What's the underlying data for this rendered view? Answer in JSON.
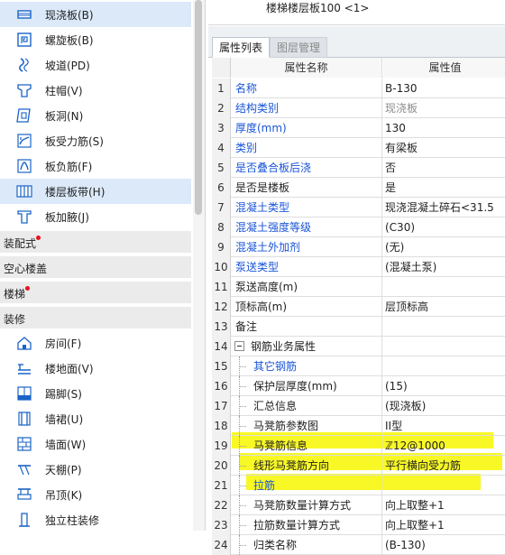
{
  "left_panel": {
    "items_top": [
      {
        "label": "现浇板(B)",
        "icon": "cast-slab-icon",
        "selected": true
      },
      {
        "label": "螺旋板(B)",
        "icon": "spiral-slab-icon",
        "selected": false
      },
      {
        "label": "坡道(PD)",
        "icon": "ramp-icon",
        "selected": false
      },
      {
        "label": "柱帽(V)",
        "icon": "column-cap-icon",
        "selected": false
      },
      {
        "label": "板洞(N)",
        "icon": "slab-hole-icon",
        "selected": false
      },
      {
        "label": "板受力筋(S)",
        "icon": "slab-main-rebar-icon",
        "selected": false
      },
      {
        "label": "板负筋(F)",
        "icon": "slab-negative-rebar-icon",
        "selected": false
      },
      {
        "label": "楼层板带(H)",
        "icon": "floor-slab-strip-icon",
        "selected": true
      },
      {
        "label": "板加腋(J)",
        "icon": "slab-haunch-icon",
        "selected": false
      }
    ],
    "groups": [
      {
        "label": "装配式",
        "has_dot": true
      },
      {
        "label": "空心楼盖",
        "has_dot": false
      },
      {
        "label": "楼梯",
        "has_dot": true
      },
      {
        "label": "装修",
        "has_dot": false
      }
    ],
    "items_bottom": [
      {
        "label": "房间(F)",
        "icon": "room-icon"
      },
      {
        "label": "楼地面(V)",
        "icon": "floor-surface-icon"
      },
      {
        "label": "踢脚(S)",
        "icon": "skirting-icon"
      },
      {
        "label": "墙裙(U)",
        "icon": "dado-icon"
      },
      {
        "label": "墙面(W)",
        "icon": "wall-surface-icon"
      },
      {
        "label": "天棚(P)",
        "icon": "ceiling-icon"
      },
      {
        "label": "吊顶(K)",
        "icon": "suspended-ceiling-icon"
      },
      {
        "label": "独立柱装修",
        "icon": "column-finish-icon"
      }
    ]
  },
  "preview": {
    "title": "楼梯楼层板100 <1>"
  },
  "tabs": [
    {
      "label": "属性列表",
      "active": true
    },
    {
      "label": "图层管理",
      "active": false
    }
  ],
  "grid": {
    "headers": {
      "name": "属性名称",
      "value": "属性值"
    },
    "rows": [
      {
        "num": "1",
        "name": "名称",
        "value": "B-130",
        "name_color": "blue",
        "value_color": "black"
      },
      {
        "num": "2",
        "name": "结构类别",
        "value": "现浇板",
        "name_color": "blue",
        "value_color": "gray"
      },
      {
        "num": "3",
        "name": "厚度(mm)",
        "value": "130",
        "name_color": "blue",
        "value_color": "black"
      },
      {
        "num": "4",
        "name": "类别",
        "value": "有梁板",
        "name_color": "blue",
        "value_color": "black"
      },
      {
        "num": "5",
        "name": "是否叠合板后浇",
        "value": "否",
        "name_color": "blue",
        "value_color": "black"
      },
      {
        "num": "6",
        "name": "是否是楼板",
        "value": "是",
        "name_color": "black",
        "value_color": "black"
      },
      {
        "num": "7",
        "name": "混凝土类型",
        "value": "现浇混凝土碎石<31.5",
        "name_color": "blue",
        "value_color": "black"
      },
      {
        "num": "8",
        "name": "混凝土强度等级",
        "value": "(C30)",
        "name_color": "blue",
        "value_color": "black"
      },
      {
        "num": "9",
        "name": "混凝土外加剂",
        "value": "(无)",
        "name_color": "blue",
        "value_color": "black"
      },
      {
        "num": "10",
        "name": "泵送类型",
        "value": "(混凝土泵)",
        "name_color": "blue",
        "value_color": "black"
      },
      {
        "num": "11",
        "name": "泵送高度(m)",
        "value": "",
        "name_color": "black",
        "value_color": "black"
      },
      {
        "num": "12",
        "name": "顶标高(m)",
        "value": "层顶标高",
        "name_color": "black",
        "value_color": "black"
      },
      {
        "num": "13",
        "name": "备注",
        "value": "",
        "name_color": "black",
        "value_color": "black"
      },
      {
        "num": "14",
        "name": "钢筋业务属性",
        "value": "",
        "name_color": "black",
        "value_color": "black",
        "group": true
      },
      {
        "num": "15",
        "name": "其它钢筋",
        "value": "",
        "name_color": "blue",
        "value_color": "black",
        "child": true
      },
      {
        "num": "16",
        "name": "保护层厚度(mm)",
        "value": "(15)",
        "name_color": "black",
        "value_color": "black",
        "child": true
      },
      {
        "num": "17",
        "name": "汇总信息",
        "value": "(现浇板)",
        "name_color": "black",
        "value_color": "black",
        "child": true
      },
      {
        "num": "18",
        "name": "马凳筋参数图",
        "value": "II型",
        "name_color": "black",
        "value_color": "black",
        "child": true
      },
      {
        "num": "19",
        "name": "马凳筋信息",
        "value": "ℤ12@1000",
        "name_color": "black",
        "value_color": "black",
        "child": true
      },
      {
        "num": "20",
        "name": "线形马凳筋方向",
        "value": "平行横向受力筋",
        "name_color": "black",
        "value_color": "black",
        "child": true
      },
      {
        "num": "21",
        "name": "拉筋",
        "value": "",
        "name_color": "blue",
        "value_color": "black",
        "child": true
      },
      {
        "num": "22",
        "name": "马凳筋数量计算方式",
        "value": "向上取整+1",
        "name_color": "black",
        "value_color": "black",
        "child": true
      },
      {
        "num": "23",
        "name": "拉筋数量计算方式",
        "value": "向上取整+1",
        "name_color": "black",
        "value_color": "black",
        "child": true
      },
      {
        "num": "24",
        "name": "归类名称",
        "value": "(B-130)",
        "name_color": "black",
        "value_color": "black",
        "child": true
      }
    ]
  },
  "colors": {
    "name_blue": "#1a55d6",
    "selection": "#dbe9f9",
    "highlighter": "#f7f700",
    "status_dot": "#e8101c"
  }
}
